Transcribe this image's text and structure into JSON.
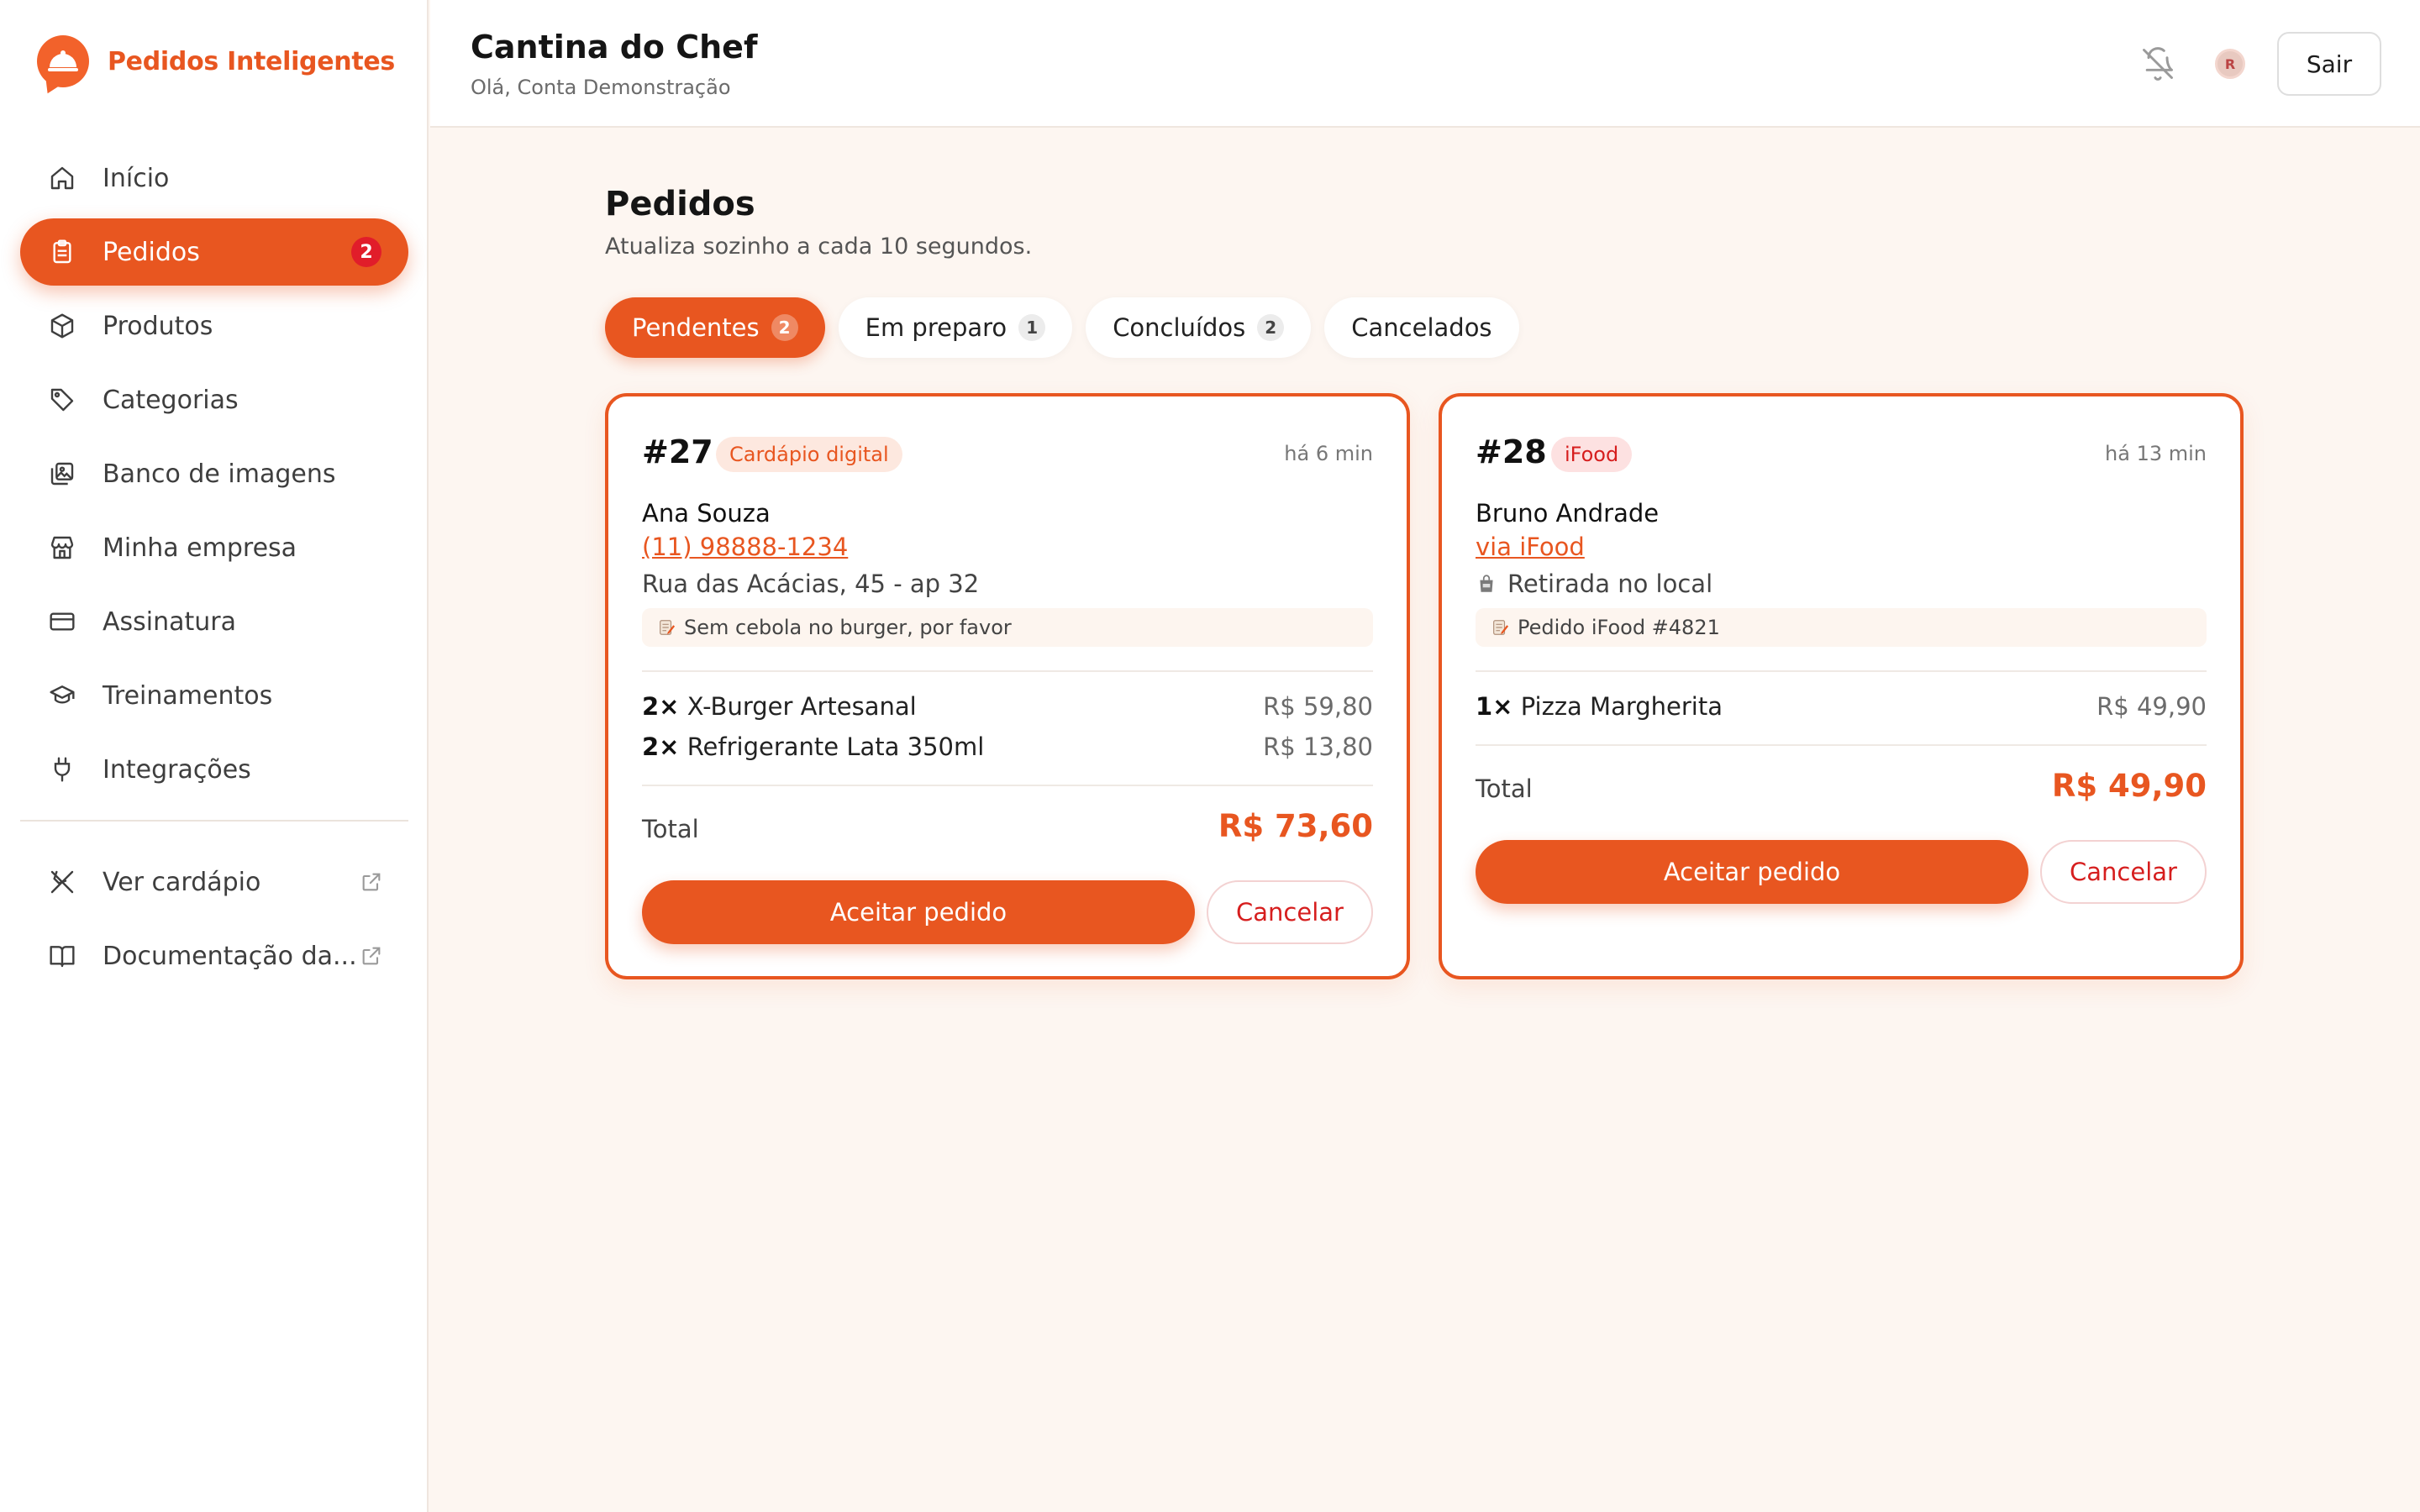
{
  "brand": {
    "name": "Pedidos Inteligentes"
  },
  "sidebar": {
    "items": [
      {
        "label": "Início",
        "icon": "home-icon"
      },
      {
        "label": "Pedidos",
        "icon": "clipboard-icon",
        "badge": "2",
        "active": true
      },
      {
        "label": "Produtos",
        "icon": "box-icon"
      },
      {
        "label": "Categorias",
        "icon": "tag-icon"
      },
      {
        "label": "Banco de imagens",
        "icon": "images-icon"
      },
      {
        "label": "Minha empresa",
        "icon": "store-icon"
      },
      {
        "label": "Assinatura",
        "icon": "credit-card-icon"
      },
      {
        "label": "Treinamentos",
        "icon": "graduation-cap-icon"
      },
      {
        "label": "Integrações",
        "icon": "plug-icon"
      }
    ],
    "links": [
      {
        "label": "Ver cardápio",
        "icon": "utensils-icon"
      },
      {
        "label": "Documentação da...",
        "icon": "book-icon"
      }
    ]
  },
  "header": {
    "title": "Cantina do Chef",
    "subtitle": "Olá, Conta Demonstração",
    "logout_label": "Sair",
    "avatar_text": "R"
  },
  "main": {
    "title": "Pedidos",
    "subtitle": "Atualiza sozinho a cada 10 segundos.",
    "tabs": [
      {
        "label": "Pendentes",
        "count": "2",
        "active": true
      },
      {
        "label": "Em preparo",
        "count": "1"
      },
      {
        "label": "Concluídos",
        "count": "2"
      },
      {
        "label": "Cancelados"
      }
    ]
  },
  "orders": [
    {
      "number": "#27",
      "source": "Cardápio digital",
      "time": "há 6 min",
      "customer": "Ana Souza",
      "contact": "(11) 98888-1234",
      "address": "Rua das Acácias, 45 - ap 32",
      "note": "Sem cebola no burger, por favor",
      "items": [
        {
          "qty": "2×",
          "name": "X-Burger Artesanal",
          "price": "R$ 59,80"
        },
        {
          "qty": "2×",
          "name": "Refrigerante Lata 350ml",
          "price": "R$ 13,80"
        }
      ],
      "total_label": "Total",
      "total": "R$ 73,60",
      "accept_label": "Aceitar pedido",
      "cancel_label": "Cancelar"
    },
    {
      "number": "#28",
      "source": "iFood",
      "time": "há 13 min",
      "customer": "Bruno Andrade",
      "contact": "via iFood",
      "address": "Retirada no local",
      "note": "Pedido iFood #4821",
      "items": [
        {
          "qty": "1×",
          "name": "Pizza Margherita",
          "price": "R$ 49,90"
        }
      ],
      "total_label": "Total",
      "total": "R$ 49,90",
      "accept_label": "Aceitar pedido",
      "cancel_label": "Cancelar"
    }
  ],
  "colors": {
    "accent": "#e85620",
    "danger": "#d61e1e",
    "background": "#fdf6f1"
  }
}
